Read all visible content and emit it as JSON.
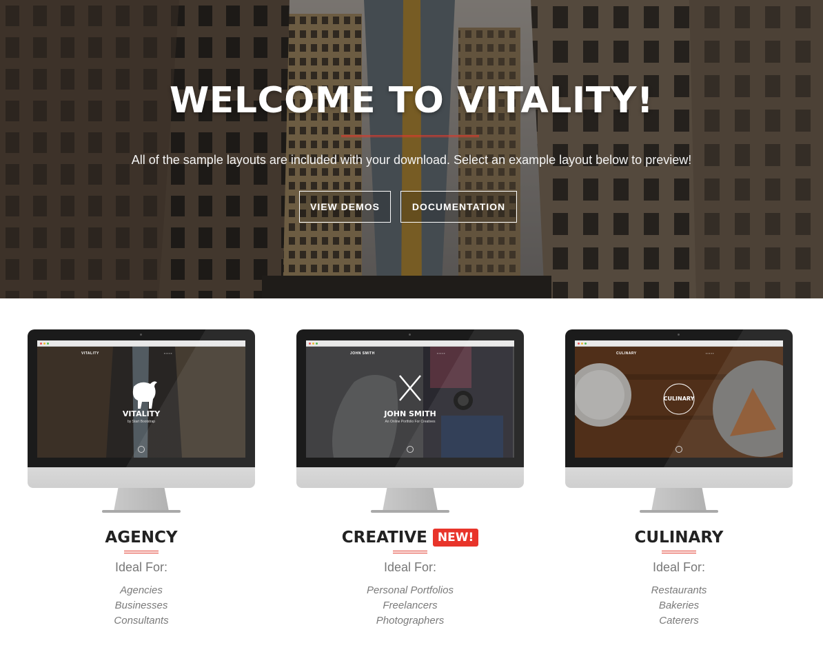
{
  "hero": {
    "title": "WELCOME TO VITALITY!",
    "subtitle": "All of the sample layouts are included with your download. Select an example layout below to preview!",
    "buttons": {
      "demos": "VIEW DEMOS",
      "docs": "DOCUMENTATION"
    },
    "accent_color": "#e0392b"
  },
  "demos": [
    {
      "title": "AGENCY",
      "badge": "",
      "ideal_label": "Ideal For:",
      "uses": [
        "Agencies",
        "Businesses",
        "Consultants"
      ],
      "screen": {
        "brand": "VITALITY",
        "site_title": "VITALITY",
        "site_sub": "by Start Bootstrap",
        "icon": "bull-logo-icon"
      }
    },
    {
      "title": "CREATIVE",
      "badge": "NEW!",
      "ideal_label": "Ideal For:",
      "uses": [
        "Personal Portfolios",
        "Freelancers",
        "Photographers"
      ],
      "screen": {
        "brand": "JOHN SMITH",
        "site_title": "JOHN SMITH",
        "site_sub": "An Online Portfolio For Creatives",
        "icon": "crossed-pencils-icon"
      }
    },
    {
      "title": "CULINARY",
      "badge": "",
      "ideal_label": "Ideal For:",
      "uses": [
        "Restaurants",
        "Bakeries",
        "Caterers"
      ],
      "screen": {
        "brand": "CULINARY",
        "site_title": "CULINARY",
        "site_sub": "",
        "icon": "culinary-badge-icon"
      }
    }
  ]
}
